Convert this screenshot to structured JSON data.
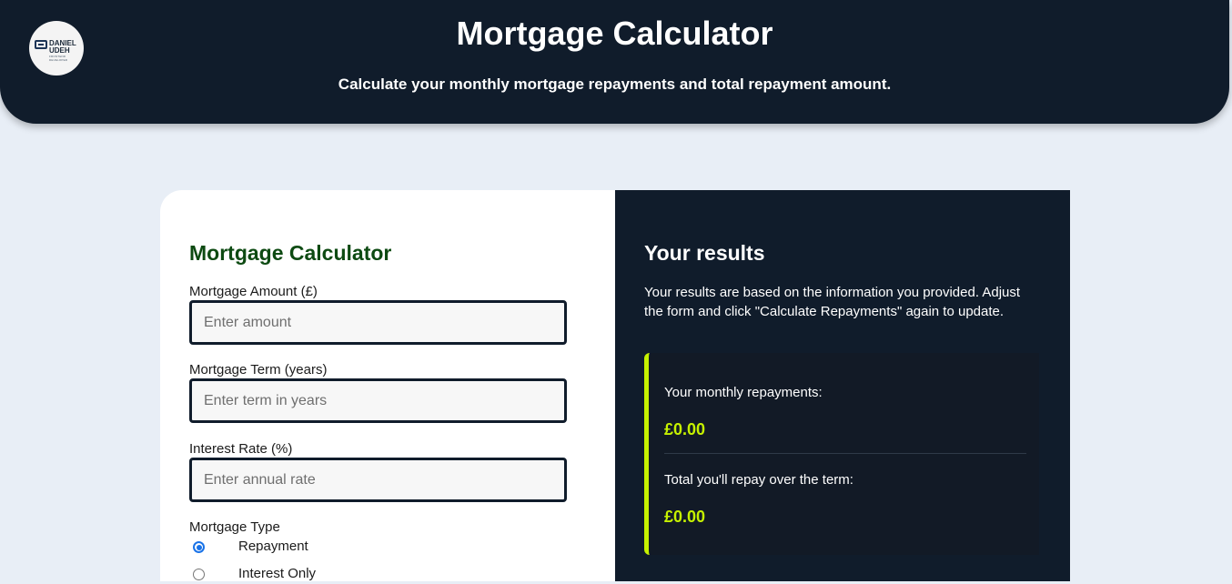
{
  "header": {
    "title": "Mortgage Calculator",
    "subtitle": "Calculate your monthly mortgage repayments and total repayment amount.",
    "logo": {
      "line1": "DANIEL",
      "line2": "UDEH",
      "tagline": "FRONTEND DEVELOPER"
    }
  },
  "form": {
    "title": "Mortgage Calculator",
    "amount": {
      "label": "Mortgage Amount (£)",
      "placeholder": "Enter amount",
      "value": ""
    },
    "term": {
      "label": "Mortgage Term (years)",
      "placeholder": "Enter term in years",
      "value": ""
    },
    "rate": {
      "label": "Interest Rate (%)",
      "placeholder": "Enter annual rate",
      "value": ""
    },
    "type": {
      "label": "Mortgage Type",
      "options": [
        {
          "label": "Repayment",
          "checked": true
        },
        {
          "label": "Interest Only",
          "checked": false
        }
      ]
    }
  },
  "results": {
    "title": "Your results",
    "description": "Your results are based on the information you provided. Adjust the form and click \"Calculate Repayments\" again to update.",
    "monthly_label": "Your monthly repayments:",
    "monthly_value": "£0.00",
    "total_label": "Total you'll repay over the term:",
    "total_value": "£0.00"
  },
  "colors": {
    "navy": "#101c2b",
    "accent": "#c6f100",
    "form_title": "#0d4a12",
    "page_bg": "#e8eef6"
  }
}
